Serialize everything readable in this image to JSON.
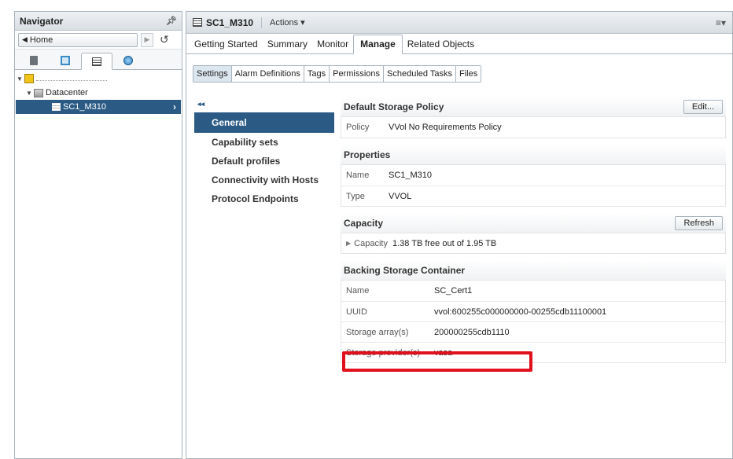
{
  "navigator": {
    "title": "Navigator",
    "home_label": "Home",
    "tree": {
      "datacenter": "Datacenter",
      "selected_item": "SC1_M310"
    }
  },
  "header": {
    "title": "SC1_M310",
    "actions_label": "Actions ▾"
  },
  "top_tabs": [
    "Getting Started",
    "Summary",
    "Monitor",
    "Manage",
    "Related Objects"
  ],
  "sub_tabs": [
    "Settings",
    "Alarm Definitions",
    "Tags",
    "Permissions",
    "Scheduled Tasks",
    "Files"
  ],
  "settings_nav": {
    "collapse": "◂◂",
    "items": [
      "General",
      "Capability sets",
      "Default profiles",
      "Connectivity with Hosts",
      "Protocol Endpoints"
    ]
  },
  "default_storage_policy": {
    "title": "Default Storage Policy",
    "edit_label": "Edit...",
    "policy_key": "Policy",
    "policy_value": "VVol No Requirements Policy"
  },
  "properties": {
    "title": "Properties",
    "name_key": "Name",
    "name_value": "SC1_M310",
    "type_key": "Type",
    "type_value": "VVOL"
  },
  "capacity": {
    "title": "Capacity",
    "refresh_label": "Refresh",
    "label": "Capacity",
    "value": "1.38 TB free out of 1.95 TB"
  },
  "backing": {
    "title": "Backing Storage Container",
    "rows": [
      {
        "key": "Name",
        "value": "SC_Cert1"
      },
      {
        "key": "UUID",
        "value": "vvol:600255c000000000-00255cdb11100001"
      },
      {
        "key": "Storage array(s)",
        "value": "200000255cdb1110"
      },
      {
        "key": "Storage provider(s)",
        "value": "vasa"
      }
    ]
  },
  "colors": {
    "selection": "#2b5b85",
    "highlight": "#e0101c"
  }
}
